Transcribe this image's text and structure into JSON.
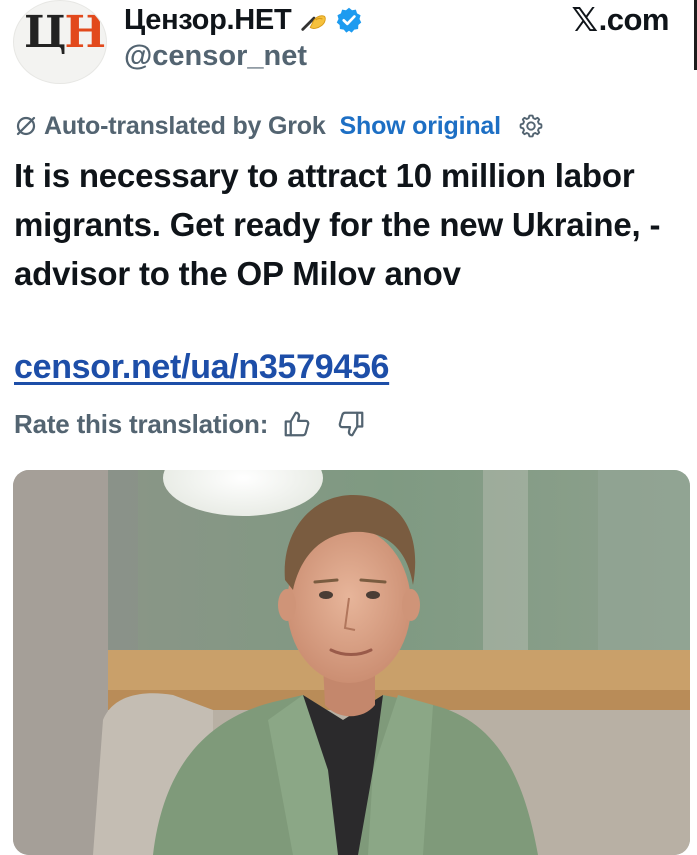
{
  "post": {
    "avatar_logo_letters": [
      "Ц",
      "Н"
    ],
    "display_name": "Цензор.НЕТ",
    "handle": "@censor_net",
    "source_site": ".com",
    "icons": {
      "emoji": "writing-hand-icon",
      "verified": "verified-badge-icon",
      "site": "x-logo-icon",
      "translate": "translate-slash-icon",
      "settings": "gear-icon",
      "thumbs_up": "thumbs-up-icon",
      "thumbs_down": "thumbs-down-icon"
    },
    "translation": {
      "label": "Auto-translated by Grok",
      "show_original": "Show original"
    },
    "text": "It is necessary to attract 10 million labor migrants. Get ready for the new Ukraine, - advisor to the OP Milov anov",
    "link": "censor.net/ua/n3579456",
    "rate_label": "Rate this translation:",
    "colors": {
      "link": "#1d4ea8",
      "show_original": "#1d6fc4",
      "secondary_text": "#536471",
      "logo_accent": "#e2491c",
      "verified": "#1d9bf0"
    }
  }
}
